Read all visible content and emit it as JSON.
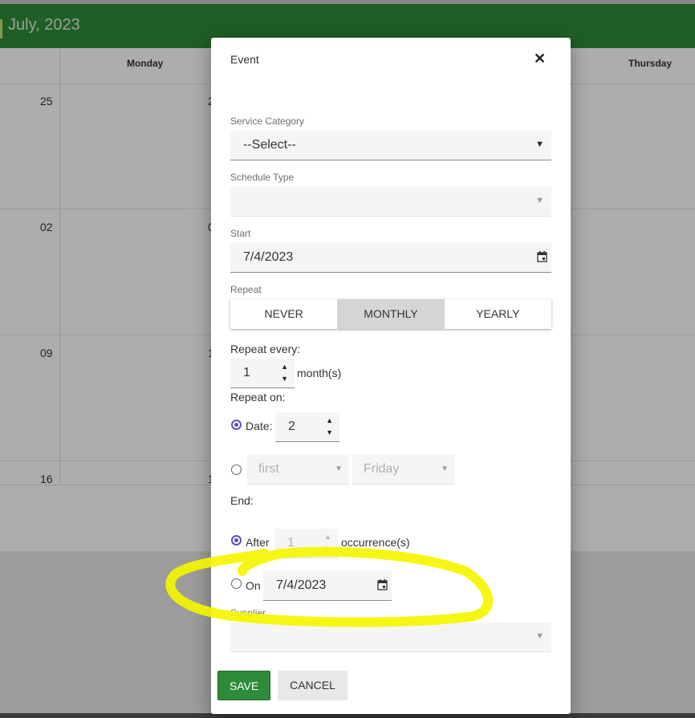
{
  "calendar": {
    "month_title": "July, 2023",
    "days": [
      "Monday",
      "Thursday"
    ],
    "partial_day_numbers": [
      "25",
      "02",
      "09",
      "16"
    ],
    "partial_monday_numbers": [
      "2",
      "0",
      "1",
      "1"
    ]
  },
  "dialog": {
    "title": "Event",
    "close_glyph": "✕",
    "service_category": {
      "label": "Service Category",
      "value": "--Select--"
    },
    "schedule_type": {
      "label": "Schedule Type",
      "value": ""
    },
    "start": {
      "label": "Start",
      "value": "7/4/2023"
    },
    "repeat": {
      "label": "Repeat",
      "options": [
        "NEVER",
        "MONTHLY",
        "YEARLY"
      ],
      "selected": "MONTHLY"
    },
    "repeat_every": {
      "label": "Repeat every:",
      "value": "1",
      "unit": "month(s)"
    },
    "repeat_on": {
      "label": "Repeat on:",
      "date_label": "Date:",
      "date_value": "2",
      "week_value": "first",
      "weekday_value": "Friday"
    },
    "end": {
      "label": "End:",
      "after_label": "After",
      "after_value": "1",
      "after_unit": "occurrence(s)",
      "on_label": "On",
      "on_value": "7/4/2023"
    },
    "supplier": {
      "label": "Supplier",
      "value": ""
    },
    "save_label": "SAVE",
    "cancel_label": "CANCEL"
  },
  "colors": {
    "header_green": "#2e8b3a",
    "radio_accent": "#5a52b8",
    "highlight_yellow": "#f5f500"
  }
}
